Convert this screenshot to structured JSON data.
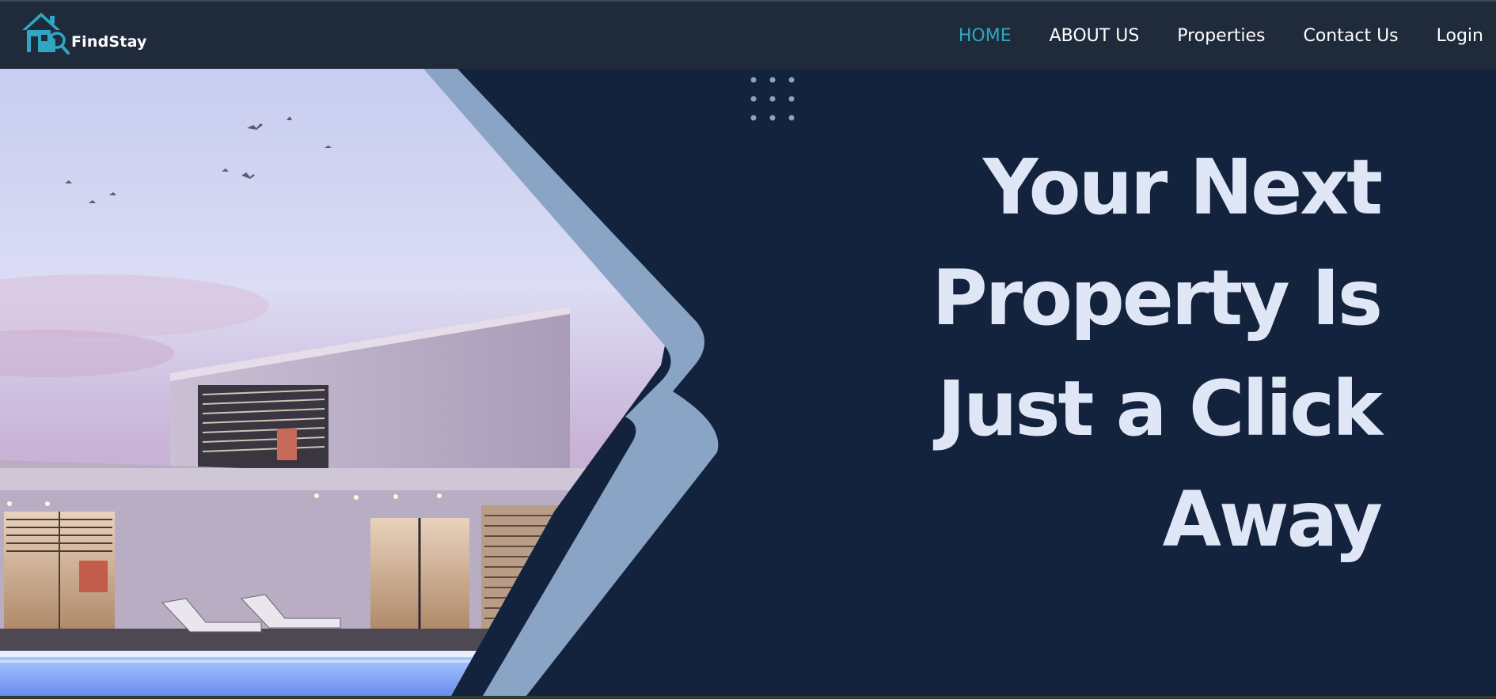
{
  "brand": {
    "name": "FindStay",
    "logo_icon": "house-search-icon",
    "accent_color": "#2fa6c4"
  },
  "nav": {
    "items": [
      {
        "label": "HOME",
        "active": true
      },
      {
        "label": "ABOUT US",
        "active": false
      },
      {
        "label": "Properties",
        "active": false
      },
      {
        "label": "Contact Us",
        "active": false
      },
      {
        "label": "Login",
        "active": false
      }
    ]
  },
  "hero": {
    "headline_lines": [
      "Your Next",
      "Property Is",
      "Just a Click",
      "Away"
    ],
    "background_color": "#13233d",
    "headline_color": "#dfe6f6",
    "frame_color": "#8aa4c6",
    "image_subject": "modern-house-with-pool-at-dusk"
  }
}
